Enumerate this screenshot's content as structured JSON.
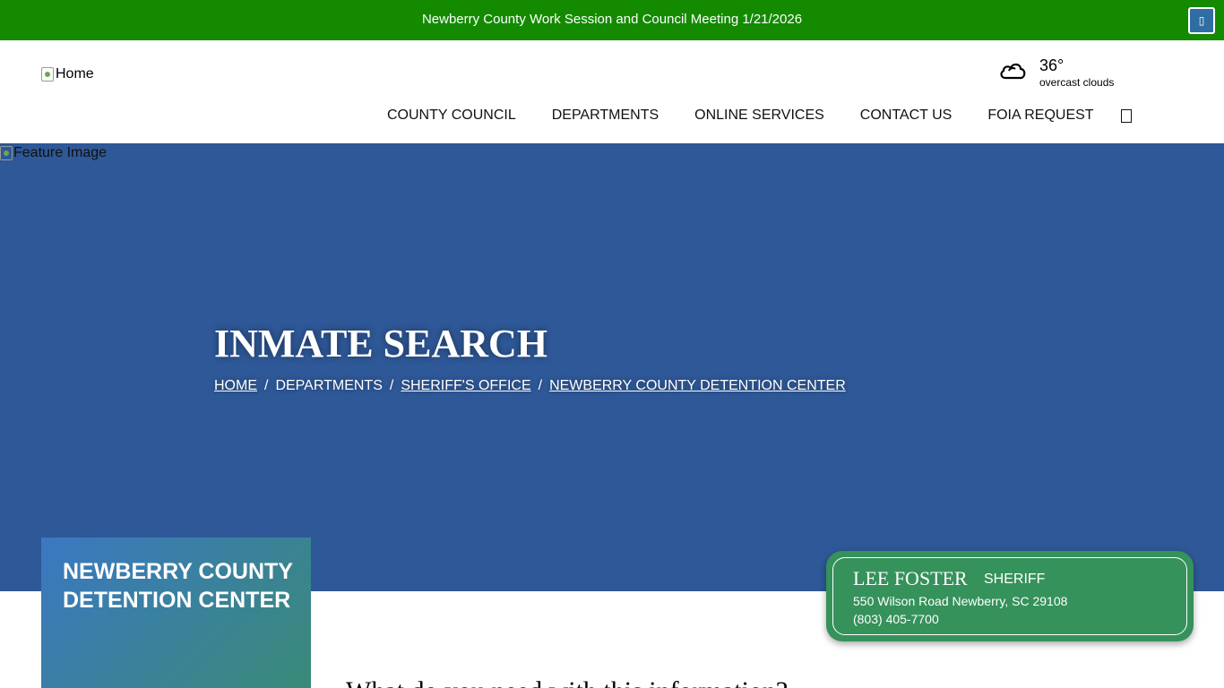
{
  "alert": {
    "text": "Newberry County Work Session and Council Meeting 1/21/2026",
    "close_label": "▯"
  },
  "header": {
    "logo_alt": "Home",
    "weather": {
      "temperature": "36°",
      "description": "overcast clouds",
      "icon": "cloud-icon"
    },
    "nav": {
      "items": [
        {
          "label": "COUNTY COUNCIL"
        },
        {
          "label": "DEPARTMENTS"
        },
        {
          "label": "ONLINE SERVICES"
        },
        {
          "label": "CONTACT US"
        },
        {
          "label": "FOIA REQUEST"
        }
      ],
      "search_icon": "search-icon"
    }
  },
  "hero": {
    "image_alt": "Feature Image",
    "title": "INMATE SEARCH",
    "breadcrumb": {
      "home": "HOME",
      "departments": "DEPARTMENTS",
      "sheriffs_office": "SHERIFF'S OFFICE",
      "detention_center": "NEWBERRY COUNTY DETENTION CENTER",
      "separator": "/"
    }
  },
  "side_panel": {
    "title": "NEWBERRY COUNTY DETENTION CENTER"
  },
  "sheriff_card": {
    "name": "LEE FOSTER",
    "role": "SHERIFF",
    "address": "550 Wilson Road Newberry, SC 29108",
    "phone": "(803) 405-7700"
  },
  "content": {
    "question_heading": "What do you need with this information?"
  },
  "colors": {
    "alert_bg": "#138a00",
    "hero_bg": "#2e5897",
    "sheriff_card_bg": "#35925a",
    "alert_close_bg": "#2f6da3"
  }
}
